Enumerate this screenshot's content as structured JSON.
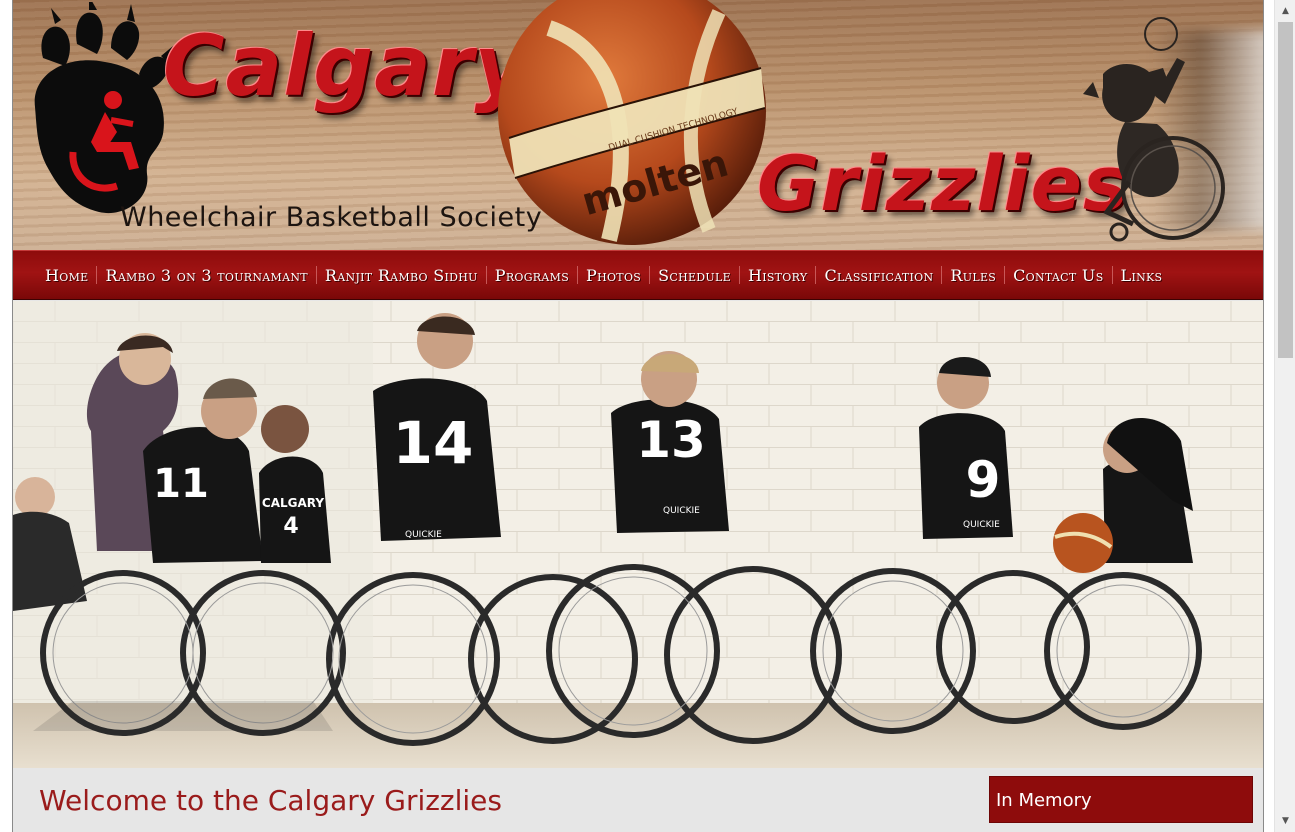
{
  "header": {
    "brand_top": "Calgary",
    "brand_bottom": "Grizzlies",
    "brand_subtitle": "Wheelchair Basketball Society",
    "ball_text_top": "DUAL CUSHION TECHNOLOGY",
    "ball_text_brand": "molten"
  },
  "nav": {
    "items": [
      {
        "label": "Home"
      },
      {
        "label": "Rambo 3 on 3 tournamant"
      },
      {
        "label": "Ranjit Rambo Sidhu"
      },
      {
        "label": "Programs"
      },
      {
        "label": "Photos"
      },
      {
        "label": "Schedule"
      },
      {
        "label": "History"
      },
      {
        "label": "Classification"
      },
      {
        "label": "Rules"
      },
      {
        "label": "Contact Us"
      },
      {
        "label": "Links"
      }
    ]
  },
  "hero": {
    "jersey_numbers": [
      "11",
      "4",
      "14",
      "13",
      "9"
    ],
    "jersey_text": "CALGARY",
    "chair_brand": "QUICKIE"
  },
  "main": {
    "welcome_title": "Welcome to the Calgary Grizzlies"
  },
  "sidebar": {
    "in_memory_title": "In Memory"
  },
  "colors": {
    "brand_red": "#c5141b",
    "nav_red": "#8e0c0c",
    "title_red": "#9a1b1b",
    "content_bg": "#e6e6e6"
  }
}
